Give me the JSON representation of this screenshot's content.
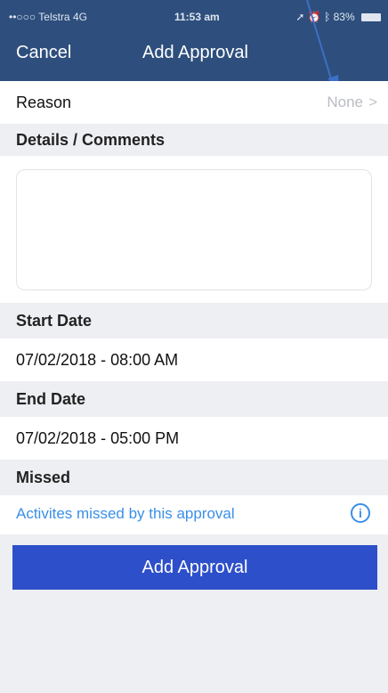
{
  "status_bar": {
    "carrier": "••○○○ Telstra 4G",
    "time": "11:53 am",
    "battery": "83%"
  },
  "nav": {
    "cancel": "Cancel",
    "title": "Add Approval"
  },
  "reason": {
    "label": "Reason",
    "value": "None",
    "chevron": ">"
  },
  "details": {
    "label": "Details / Comments",
    "value": ""
  },
  "start_date": {
    "label": "Start Date",
    "value": "07/02/2018 - 08:00 AM"
  },
  "end_date": {
    "label": "End Date",
    "value": "07/02/2018 - 05:00 PM"
  },
  "missed": {
    "label": "Missed",
    "link": "Activites missed by this approval",
    "icon": "info-icon"
  },
  "action": {
    "add_label": "Add Approval"
  },
  "colors": {
    "nav_bg": "#2e4f7d",
    "accent_blue": "#2d4fc9",
    "link_blue": "#3a8fe8",
    "section_bg": "#eeeff2"
  }
}
